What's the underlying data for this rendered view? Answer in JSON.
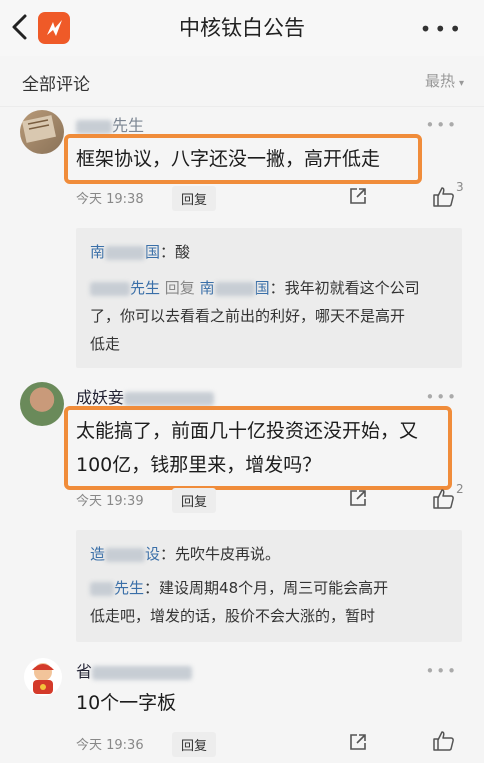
{
  "header": {
    "title": "中核钛白公告",
    "more": "•••"
  },
  "filter": {
    "title": "全部评论",
    "sort": "最热",
    "sort_arrow": "▾"
  },
  "comments": [
    {
      "author_suffix": "先生",
      "text": "框架协议，八字还没一撇，高开低走",
      "time": "今天 19:38",
      "reply": "回复",
      "likes": "3",
      "more": "•••",
      "replies": [
        {
          "name_a": "南",
          "name_b": "国",
          "sep": "：",
          "text": "酸"
        },
        {
          "name_a": "先生",
          "verb": "回复",
          "name_b": "南",
          "name_c": "国",
          "sep": "：",
          "text1": "我年初就看这个公司",
          "text2": "了，你可以去看看之前出的利好，哪天不是高开",
          "text3": "低走"
        }
      ]
    },
    {
      "author_prefix": "成妖妾",
      "line1": "太能搞了，前面几十亿投资还没开始，又",
      "line2": "100亿，钱那里来，增发吗？",
      "time": "今天 19:39",
      "reply": "回复",
      "likes": "2",
      "more": "•••",
      "replies": [
        {
          "name_a": "造",
          "name_b": "设",
          "sep": "：",
          "text": "先吹牛皮再说。"
        },
        {
          "name_a": "先生",
          "sep": "：",
          "text1": "建设周期48个月，周三可能会高开",
          "text2": "低走吧，增发的话，股价不会大涨的，暂时"
        }
      ]
    },
    {
      "author_prefix": "省",
      "text": "10个一字板",
      "time": "今天 19:36",
      "reply": "回复",
      "more": "•••"
    }
  ]
}
